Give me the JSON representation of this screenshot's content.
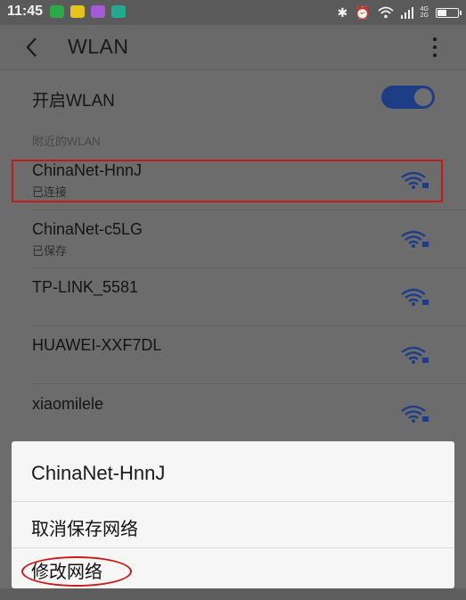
{
  "status_bar": {
    "time": "11:45",
    "notification_icons": [
      "app-notification-icon",
      "app-notification-icon",
      "app-notification-icon",
      "app-notification-icon"
    ],
    "notification_colors": [
      "#2aa84a",
      "#e6c21c",
      "#a45bd6",
      "#23a98c"
    ],
    "right_icons": [
      "bluetooth-icon",
      "alarm-icon",
      "wifi-icon",
      "signal-icon",
      "battery-icon"
    ],
    "network_type_top": "4G",
    "network_type_bottom": "2G"
  },
  "action_bar": {
    "title": "WLAN"
  },
  "wlan_toggle": {
    "label": "开启WLAN",
    "enabled": true
  },
  "nearby_section": {
    "header": "附近的WLAN"
  },
  "networks": [
    {
      "name": "ChinaNet-HnnJ",
      "status": "已连接"
    },
    {
      "name": "ChinaNet-c5LG",
      "status": "已保存"
    },
    {
      "name": "TP-LINK_5581",
      "status": ""
    },
    {
      "name": "HUAWEI-XXF7DL",
      "status": ""
    },
    {
      "name": "xiaomilele",
      "status": ""
    }
  ],
  "dialog": {
    "title": "ChinaNet-HnnJ",
    "items": [
      {
        "label": "取消保存网络"
      },
      {
        "label": "修改网络"
      }
    ]
  },
  "colors": {
    "accent": "#1d3e86",
    "annotation_red": "#c41a1a",
    "dialog_bg": "#f6f6f6"
  }
}
